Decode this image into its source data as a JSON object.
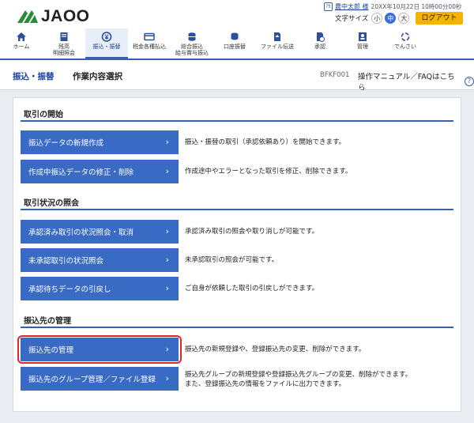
{
  "header": {
    "logo_text": "JAOO",
    "user_icon": "ｱｶ",
    "user_name": "農中太郎 様",
    "datetime": "20XX年10月22日 10時00分00秒",
    "fontsize_label": "文字サイズ",
    "fontsize_options": [
      "小",
      "中",
      "大"
    ],
    "fontsize_selected": "中",
    "logout_label": "ログアウト"
  },
  "nav": {
    "items": [
      {
        "label": "ホーム",
        "icon": "home-icon"
      },
      {
        "label": "残高\n明細照会",
        "icon": "passbook-icon"
      },
      {
        "label": "振込・振替",
        "icon": "yen-coin-icon"
      },
      {
        "label": "税金各種払込",
        "icon": "card-icon"
      },
      {
        "label": "総合振込\n給与賞与振込",
        "icon": "coins-stack-icon"
      },
      {
        "label": "口座振替",
        "icon": "coins-icon"
      },
      {
        "label": "ファイル伝送",
        "icon": "file-upload-icon"
      },
      {
        "label": "承認",
        "icon": "approve-doc-icon"
      },
      {
        "label": "管理",
        "icon": "admin-icon"
      },
      {
        "label": "でんさい",
        "icon": "densai-icon"
      }
    ],
    "active": "振込・振替"
  },
  "page": {
    "category": "振込・振替",
    "title": "作業内容選択",
    "code": "BFKF001",
    "help_label": "操作マニュアル／FAQはこちら",
    "help_icon": "?"
  },
  "sections": [
    {
      "title": "取引の開始",
      "actions": [
        {
          "label": "振込データの新規作成",
          "desc": "振込・振替の取引（承認依頼あり）を開始できます。"
        },
        {
          "label": "作成中振込データの修正・削除",
          "desc": "作成途中やエラーとなった取引を修正、削除できます。"
        }
      ]
    },
    {
      "title": "取引状況の照会",
      "actions": [
        {
          "label": "承認済み取引の状況照会・取消",
          "desc": "承認済み取引の照会や取り消しが可能です。"
        },
        {
          "label": "未承認取引の状況照会",
          "desc": "未承認取引の照会が可能です。"
        },
        {
          "label": "承認待ちデータの引戻し",
          "desc": "ご自身が依頼した取引の引戻しができます。"
        }
      ]
    },
    {
      "title": "振込先の管理",
      "actions": [
        {
          "label": "振込先の管理",
          "desc": "振込先の新規登録や、登録振込先の変更、削除ができます。"
        },
        {
          "label": "振込先のグループ管理／ファイル登録",
          "desc": "振込先グループの新規登録や登録振込先グループの変更、削除ができます。\nまた、登録振込先の情報をファイルに出力できます。"
        }
      ]
    }
  ],
  "chevron": "›",
  "colors": {
    "brand_blue": "#3a6bc4",
    "nav_line": "#3b5fa8",
    "logout_bg": "#f5b200",
    "highlight": "#e3252b"
  }
}
